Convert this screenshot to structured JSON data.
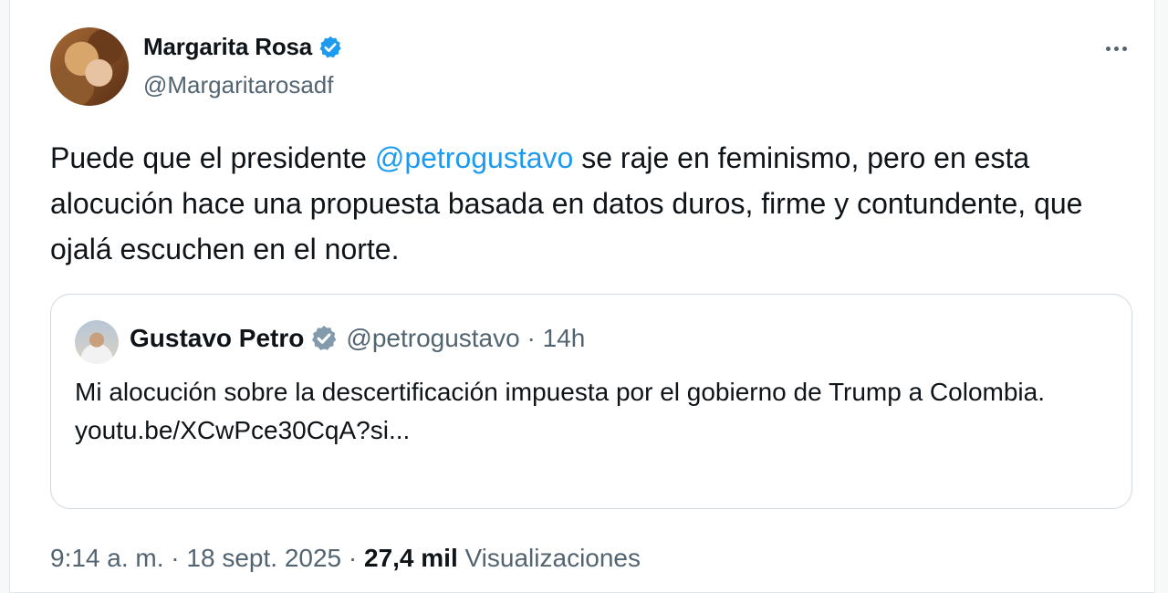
{
  "author": {
    "display_name": "Margarita Rosa",
    "handle": "@Margaritarosadf"
  },
  "tweet": {
    "text_before": "Puede que el presidente ",
    "mention": "@petrogustavo",
    "text_after": " se raje en feminismo,  pero en esta alocución hace una propuesta basada en datos duros, firme y contundente, que ojalá escuchen en el norte."
  },
  "quoted": {
    "display_name": "Gustavo Petro",
    "handle": "@petrogustavo",
    "separator": " · ",
    "time": "14h",
    "text": "Mi alocución sobre la descertificación impuesta por el gobierno de Trump a Colombia.",
    "link": "youtu.be/XCwPce30CqA?si..."
  },
  "footer": {
    "time": "9:14 a. m.",
    "separator": " · ",
    "date": "18 sept. 2025",
    "views_count": "27,4 mil",
    "views_label": "Visualizaciones"
  },
  "icons": {
    "verified_primary": "verified-badge-blue",
    "verified_quoted": "verified-badge-gray",
    "more": "more-horizontal"
  },
  "colors": {
    "link": "#1d9bf0",
    "verified_blue": "#1d9bf0",
    "verified_gray": "#829aab",
    "muted_text": "#536471",
    "text": "#0f1419"
  }
}
